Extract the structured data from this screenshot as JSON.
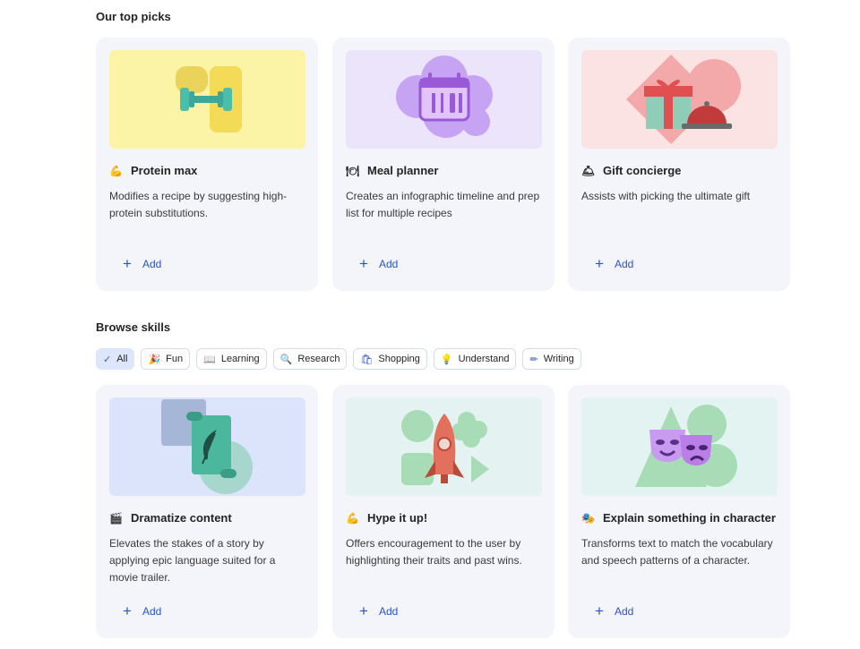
{
  "top_picks": {
    "heading": "Our top picks",
    "cards": [
      {
        "icon": "flexed-biceps-icon",
        "emoji": "💪",
        "title": "Protein max",
        "description": "Modifies a recipe by suggesting high-protein substitutions.",
        "add_label": "Add"
      },
      {
        "icon": "fork-knife-plate-icon",
        "emoji": "🍽",
        "title": "Meal planner",
        "description": "Creates an infographic timeline and prep list for multiple recipes",
        "add_label": "Add"
      },
      {
        "icon": "bell-icon",
        "emoji": "🛎",
        "title": "Gift concierge",
        "description": "Assists with picking the ultimate gift",
        "add_label": "Add"
      }
    ]
  },
  "browse": {
    "heading": "Browse skills",
    "filters": [
      {
        "icon": "checkmark-icon",
        "glyph": "✓",
        "label": "All",
        "selected": true
      },
      {
        "icon": "party-popper-icon",
        "glyph": "🎉",
        "label": "Fun",
        "selected": false
      },
      {
        "icon": "book-icon",
        "glyph": "📖",
        "label": "Learning",
        "selected": false
      },
      {
        "icon": "search-list-icon",
        "glyph": "🔍",
        "label": "Research",
        "selected": false
      },
      {
        "icon": "shopping-bag-icon",
        "glyph": "🛍",
        "label": "Shopping",
        "selected": false
      },
      {
        "icon": "lightbulb-icon",
        "glyph": "💡",
        "label": "Understand",
        "selected": false
      },
      {
        "icon": "pen-icon",
        "glyph": "✏",
        "label": "Writing",
        "selected": false
      }
    ],
    "cards": [
      {
        "icon": "clapper-board-icon",
        "emoji": "🎬",
        "title": "Dramatize content",
        "description": "Elevates the stakes of a story by applying epic language suited for a movie trailer.",
        "add_label": "Add"
      },
      {
        "icon": "flexed-arm-icon",
        "emoji": "💪",
        "title": "Hype it up!",
        "description": "Offers encouragement to the user by highlighting their traits and past wins.",
        "add_label": "Add"
      },
      {
        "icon": "performing-arts-icon",
        "emoji": "🎭",
        "title": "Explain something in character",
        "description": "Transforms text to match the vocabulary and speech patterns of a character.",
        "add_label": "Add"
      }
    ]
  },
  "colors": {
    "card_bg": "#f4f4fb",
    "accent": "#2a55c4",
    "chip_selected": "#dde6fb"
  }
}
